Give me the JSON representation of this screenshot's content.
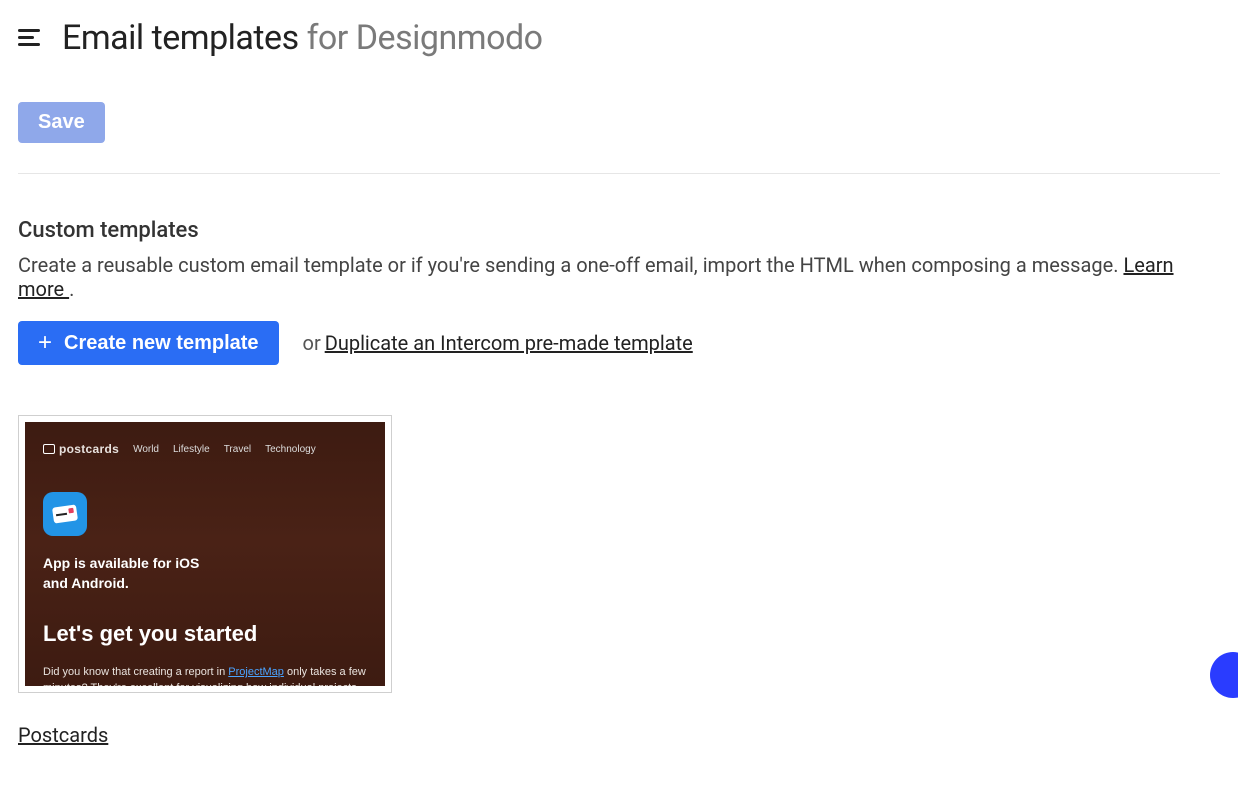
{
  "header": {
    "title_main": "Email templates",
    "title_sub": "for Designmodo"
  },
  "buttons": {
    "save": "Save",
    "create_new_template": "Create new template"
  },
  "section": {
    "heading": "Custom templates",
    "description": "Create a reusable custom email template or if you're sending a one-off email, import the HTML when composing a message. ",
    "learn_more": "Learn more ",
    "or_text": "or",
    "duplicate_link": "Duplicate an Intercom pre-made template"
  },
  "template_card": {
    "name": "Postcards",
    "preview": {
      "brand": "postcards",
      "nav": [
        "World",
        "Lifestyle",
        "Travel",
        "Technology"
      ],
      "availability_line1": "App is available for iOS",
      "availability_line2": "and Android.",
      "heading": "Let's get you started",
      "body_pre": "Did you know that creating a report in ",
      "body_link": "ProjectMap",
      "body_post": " only takes a few minutes? They're excellent for visualizing how individual projects are performing, along with identifying which team members are hitting or"
    }
  }
}
